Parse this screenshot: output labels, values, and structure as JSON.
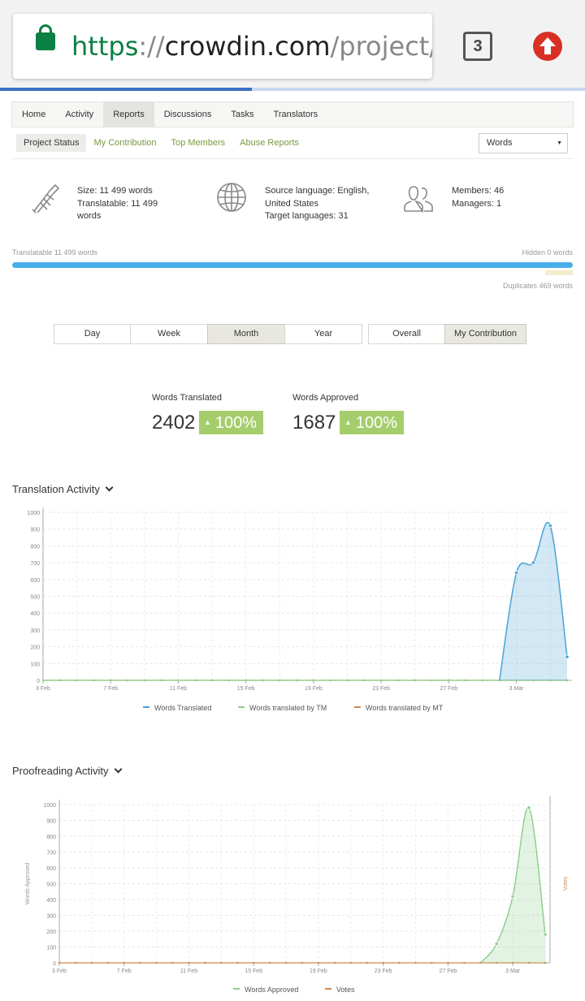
{
  "browser": {
    "url_scheme": "https",
    "url_sep": "://",
    "url_host": "crowdin.com",
    "url_path": "/project/li",
    "tab_count": "3",
    "lock_icon": "lock-icon",
    "update_icon": "arrow-up-icon"
  },
  "nav": {
    "items": [
      "Home",
      "Activity",
      "Reports",
      "Discussions",
      "Tasks",
      "Translators"
    ],
    "active": "Reports"
  },
  "subnav": {
    "items": [
      "Project Status",
      "My Contribution",
      "Top Members",
      "Abuse Reports"
    ],
    "active": "Project Status"
  },
  "unit_select": {
    "value": "Words"
  },
  "stats": {
    "size": {
      "icon": "calipers-icon",
      "lines": [
        "Size: 11 499 words",
        "Translatable: 11 499",
        "words"
      ]
    },
    "languages": {
      "icon": "globe-icon",
      "lines": [
        "Source language: English,",
        "United States",
        "Target languages: 31"
      ]
    },
    "members": {
      "icon": "users-icon",
      "lines": [
        "Members: 46",
        "Managers: 1"
      ]
    }
  },
  "progress": {
    "left_label": "Translatable 11 499 words",
    "right_label": "Hidden 0 words",
    "dup_label": "Duplicates 469 words"
  },
  "periods": {
    "items": [
      "Day",
      "Week",
      "Month",
      "Year"
    ],
    "active": "Month"
  },
  "scope": {
    "items": [
      "Overall",
      "My Contribution"
    ],
    "active": "My Contribution"
  },
  "metrics": {
    "translated": {
      "label": "Words Translated",
      "value": "2402",
      "change": "100%"
    },
    "approved": {
      "label": "Words Approved",
      "value": "1687",
      "change": "100%"
    }
  },
  "colors": {
    "translated": "#4aa3d6",
    "tm": "#8bcf8f",
    "mt": "#d08a4b",
    "approved": "#8fd090",
    "votes": "#d08a4b",
    "badge": "#a5cd6c",
    "link": "#7a9a3d"
  },
  "chart_data": [
    {
      "type": "area",
      "title": "Translation Activity",
      "x_ticks": [
        "3 Feb",
        "7 Feb",
        "11 Feb",
        "15 Feb",
        "19 Feb",
        "23 Feb",
        "27 Feb",
        "3 Mar"
      ],
      "y_ticks": [
        0,
        100,
        200,
        300,
        400,
        500,
        600,
        700,
        800,
        900,
        1000
      ],
      "ylim": [
        0,
        1000
      ],
      "x_days": 31,
      "grid": true,
      "legend_position": "bottom",
      "series": [
        {
          "name": "Words Translated",
          "color": "#4aa3d6",
          "fill": true,
          "points": [
            [
              27,
              0
            ],
            [
              28,
              640
            ],
            [
              29,
              700
            ],
            [
              30,
              920
            ],
            [
              31,
              140
            ]
          ]
        },
        {
          "name": "Words translated by TM",
          "color": "#8bcf8f",
          "fill": false,
          "points": [
            [
              0,
              0
            ],
            [
              31,
              0
            ]
          ]
        },
        {
          "name": "Words translated by MT",
          "color": "#d08a4b",
          "fill": false,
          "points": [
            [
              0,
              0
            ],
            [
              31,
              0
            ]
          ]
        }
      ]
    },
    {
      "type": "area",
      "title": "Proofreading Activity",
      "ylabel": "Words Approved",
      "y2label": "Votes",
      "x_ticks": [
        "3 Feb",
        "7 Feb",
        "11 Feb",
        "15 Feb",
        "19 Feb",
        "23 Feb",
        "27 Feb",
        "3 Mar"
      ],
      "y_ticks": [
        0,
        100,
        200,
        300,
        400,
        500,
        600,
        700,
        800,
        900,
        1000
      ],
      "ylim": [
        0,
        1000
      ],
      "x_days": 30,
      "grid": true,
      "legend_position": "bottom",
      "series": [
        {
          "name": "Words Approved",
          "color": "#8fd090",
          "fill": true,
          "points": [
            [
              26,
              0
            ],
            [
              27,
              120
            ],
            [
              28,
              420
            ],
            [
              29,
              980
            ],
            [
              30,
              180
            ]
          ]
        },
        {
          "name": "Votes",
          "color": "#d08a4b",
          "fill": false,
          "points": [
            [
              0,
              0
            ],
            [
              30,
              0
            ]
          ]
        }
      ]
    }
  ]
}
